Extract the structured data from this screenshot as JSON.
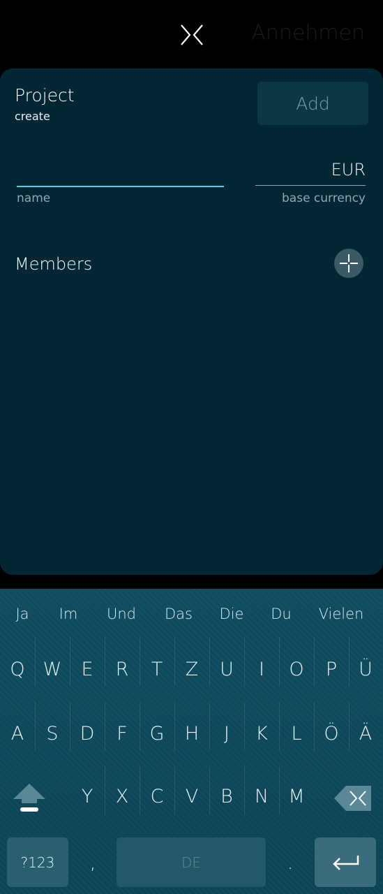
{
  "header": {
    "accept_label": "Annehmen",
    "close_icon": "close-icon"
  },
  "dialog": {
    "title": "Project",
    "subtitle": "create",
    "add_label": "Add",
    "name_value": "",
    "name_label": "name",
    "currency_value": "EUR",
    "currency_label": "base currency",
    "members_label": "Members",
    "add_member_icon": "plus-icon"
  },
  "keyboard": {
    "suggestions": [
      "Ja",
      "Im",
      "Und",
      "Das",
      "Die",
      "Du",
      "Vielen"
    ],
    "row1": [
      "Q",
      "W",
      "E",
      "R",
      "T",
      "Z",
      "U",
      "I",
      "O",
      "P",
      "Ü"
    ],
    "row2": [
      "A",
      "S",
      "D",
      "F",
      "G",
      "H",
      "J",
      "K",
      "L",
      "Ö",
      "Ä"
    ],
    "row3": [
      "Y",
      "X",
      "C",
      "V",
      "B",
      "N",
      "M"
    ],
    "symbols_label": "?123",
    "comma_label": ",",
    "space_label": "DE",
    "period_label": ".",
    "accent_color": "#5ecbe6"
  }
}
